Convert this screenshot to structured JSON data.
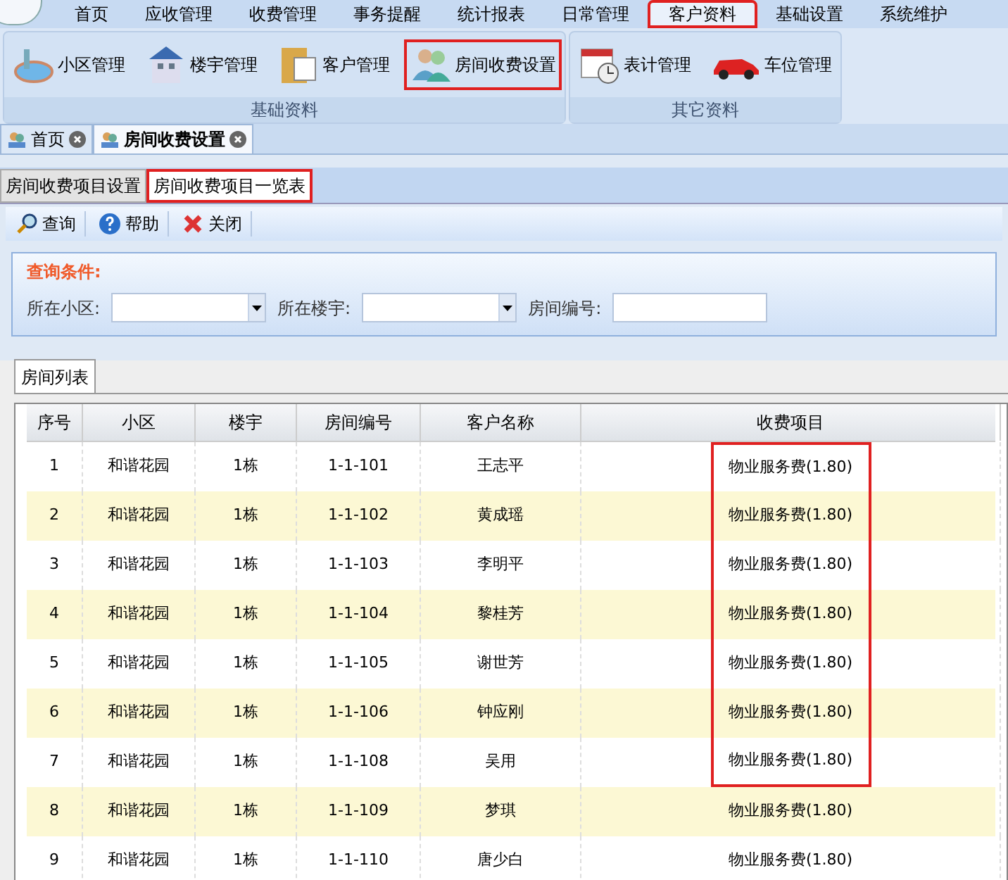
{
  "menu": [
    {
      "label": "首页",
      "selected": false
    },
    {
      "label": "应收管理",
      "selected": false
    },
    {
      "label": "收费管理",
      "selected": false
    },
    {
      "label": "事务提醒",
      "selected": false
    },
    {
      "label": "统计报表",
      "selected": false
    },
    {
      "label": "日常管理",
      "selected": false
    },
    {
      "label": "客户资料",
      "selected": true
    },
    {
      "label": "基础设置",
      "selected": false
    },
    {
      "label": "系统维护",
      "selected": false
    }
  ],
  "ribbon_groups": [
    {
      "title": "基础资料",
      "items": [
        {
          "label": "小区管理",
          "kind": "pool",
          "highlighted": false
        },
        {
          "label": "楼宇管理",
          "kind": "building",
          "highlighted": false
        },
        {
          "label": "客户管理",
          "kind": "folder",
          "highlighted": false
        },
        {
          "label": "房间收费设置",
          "kind": "users",
          "highlighted": true
        }
      ]
    },
    {
      "title": "其它资料",
      "items": [
        {
          "label": "表计管理",
          "kind": "clock",
          "highlighted": false
        },
        {
          "label": "车位管理",
          "kind": "car",
          "highlighted": false
        }
      ]
    }
  ],
  "doc_tabs": [
    {
      "label": "首页",
      "selected": false
    },
    {
      "label": "房间收费设置",
      "selected": true
    }
  ],
  "sub_tabs": [
    {
      "label": "房间收费项目设置",
      "selected": false
    },
    {
      "label": "房间收费项目一览表",
      "selected": true
    }
  ],
  "toolbar": [
    {
      "label": "查询",
      "kind": "search"
    },
    {
      "label": "帮助",
      "kind": "help"
    },
    {
      "label": "关闭",
      "kind": "close"
    }
  ],
  "query": {
    "title": "查询条件:",
    "fields": [
      {
        "label": "所在小区:",
        "kind": "select"
      },
      {
        "label": "所在楼宇:",
        "kind": "select"
      },
      {
        "label": "房间编号:",
        "kind": "text"
      }
    ]
  },
  "list_tab": "房间列表",
  "table": {
    "columns": [
      "序号",
      "小区",
      "楼宇",
      "房间编号",
      "客户名称",
      "收费项目"
    ],
    "rows": [
      {
        "cells": [
          "1",
          "和谐花园",
          "1栋",
          "1-1-101",
          "王志平",
          "物业服务费(1.80)"
        ],
        "highlighted": true
      },
      {
        "cells": [
          "2",
          "和谐花园",
          "1栋",
          "1-1-102",
          "黄成瑶",
          "物业服务费(1.80)"
        ],
        "highlighted": true
      },
      {
        "cells": [
          "3",
          "和谐花园",
          "1栋",
          "1-1-103",
          "李明平",
          "物业服务费(1.80)"
        ],
        "highlighted": true
      },
      {
        "cells": [
          "4",
          "和谐花园",
          "1栋",
          "1-1-104",
          "黎桂芳",
          "物业服务费(1.80)"
        ],
        "highlighted": true
      },
      {
        "cells": [
          "5",
          "和谐花园",
          "1栋",
          "1-1-105",
          "谢世芳",
          "物业服务费(1.80)"
        ],
        "highlighted": true
      },
      {
        "cells": [
          "6",
          "和谐花园",
          "1栋",
          "1-1-106",
          "钟应刚",
          "物业服务费(1.80)"
        ],
        "highlighted": true
      },
      {
        "cells": [
          "7",
          "和谐花园",
          "1栋",
          "1-1-108",
          "吴用",
          "物业服务费(1.80)"
        ],
        "highlighted": true
      },
      {
        "cells": [
          "8",
          "和谐花园",
          "1栋",
          "1-1-109",
          "梦琪",
          "物业服务费(1.80)"
        ],
        "highlighted": false
      },
      {
        "cells": [
          "9",
          "和谐花园",
          "1栋",
          "1-1-110",
          "唐少白",
          "物业服务费(1.80)"
        ],
        "highlighted": false
      }
    ]
  }
}
